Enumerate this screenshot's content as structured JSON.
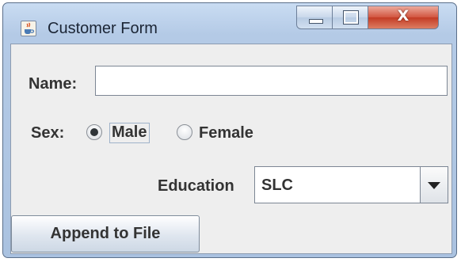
{
  "window": {
    "title": "Customer Form",
    "icon": "java-cup-icon",
    "controls": {
      "minimize_icon": "minimize-icon",
      "maximize_icon": "maximize-icon",
      "close_label": "X"
    }
  },
  "form": {
    "name_label": "Name:",
    "name_value": "",
    "sex_label": "Sex:",
    "sex_options": [
      {
        "label": "Male",
        "selected": true
      },
      {
        "label": "Female",
        "selected": false
      }
    ],
    "education_label": "Education",
    "education_value": "SLC",
    "append_button": "Append to File"
  },
  "colors": {
    "title_bar": "#b4cae6",
    "close_button": "#c33b24",
    "client_background": "#eeeeee"
  }
}
